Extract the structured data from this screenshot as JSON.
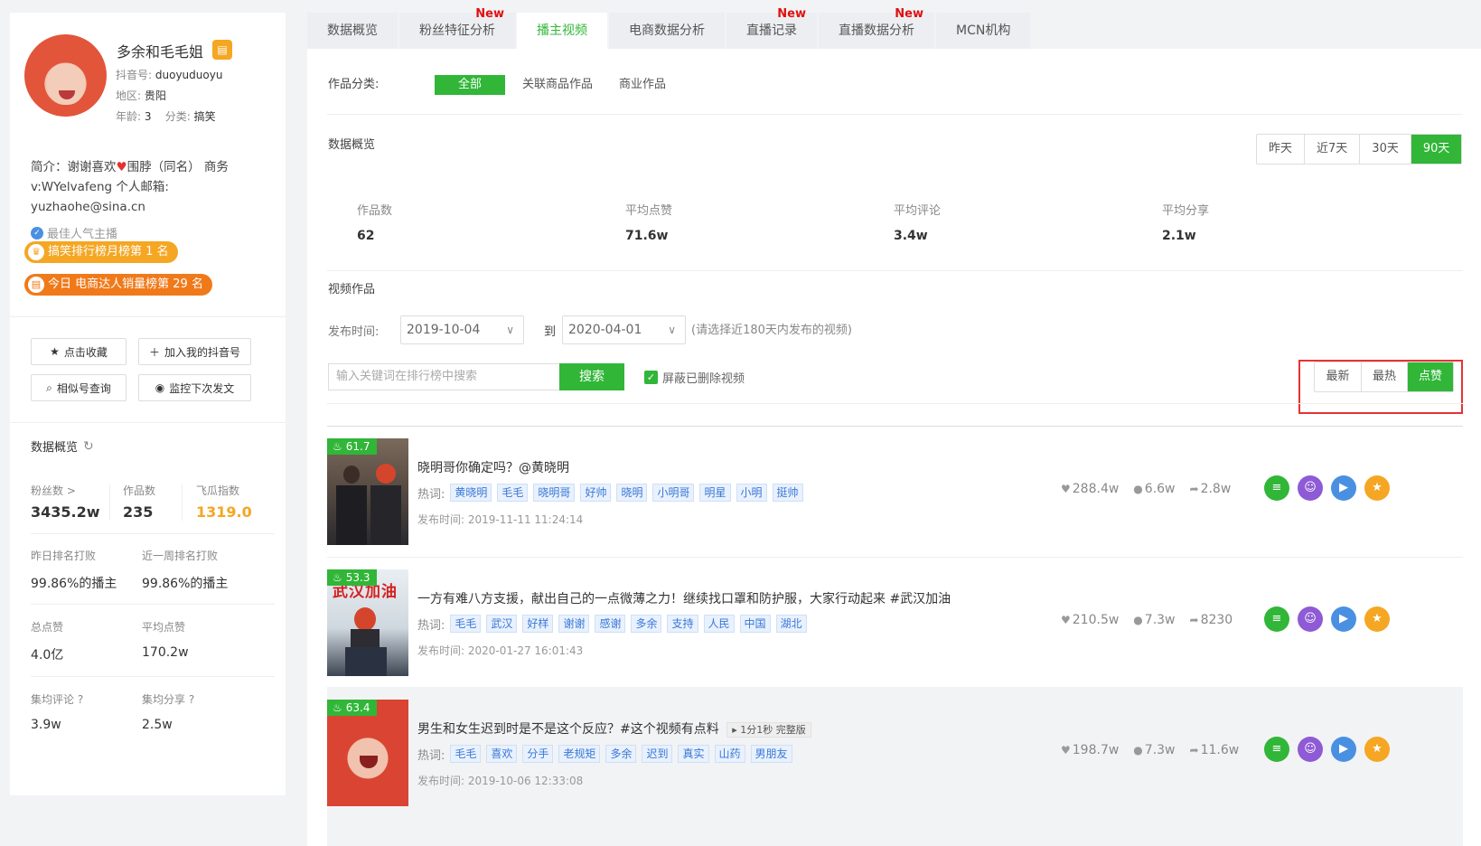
{
  "profile": {
    "name": "多余和毛毛姐",
    "badge_icon": "shop-icon",
    "douyin_label": "抖音号:",
    "douyin_id": "duoyuduoyu",
    "region_label": "地区:",
    "region": "贵阳",
    "age_label": "年龄:",
    "age": "3",
    "category_label": "分类:",
    "category": "搞笑",
    "intro_line1_a": "简介：谢谢喜欢",
    "intro_line1_b": "围脖（同名） 商务",
    "intro_line2": "v:WYelvafeng 个人邮箱:",
    "intro_line3": "yuzhaohe@sina.cn",
    "verified": "最佳人气主播",
    "rank1": "搞笑排行榜月榜第 1 名",
    "rank2": "今日 电商达人销量榜第 29 名"
  },
  "actions": {
    "favorite": "点击收藏",
    "add": "加入我的抖音号",
    "similar": "相似号查询",
    "monitor": "监控下次发文"
  },
  "stats": {
    "title": "数据概览",
    "fans_label": "粉丝数 >",
    "fans": "3435.2w",
    "works_label": "作品数",
    "works": "235",
    "index_label": "飞瓜指数",
    "index": "1319.0",
    "yest_rank_label": "昨日排名打败",
    "yest_rank": "99.86%的播主",
    "week_rank_label": "近一周排名打败",
    "week_rank": "99.86%的播主",
    "total_likes_label": "总点赞",
    "total_likes": "4.0亿",
    "avg_likes_label": "平均点赞",
    "avg_likes": "170.2w",
    "avg_comments_label": "集均评论 ?",
    "avg_comments": "3.9w",
    "avg_shares_label": "集均分享 ?",
    "avg_shares": "2.5w"
  },
  "tabs": [
    {
      "label": "数据概览",
      "new": ""
    },
    {
      "label": "粉丝特征分析",
      "new": "New"
    },
    {
      "label": "播主视频",
      "new": ""
    },
    {
      "label": "电商数据分析",
      "new": ""
    },
    {
      "label": "直播记录",
      "new": "New"
    },
    {
      "label": "直播数据分析",
      "new": "New"
    },
    {
      "label": "MCN机构",
      "new": ""
    }
  ],
  "category": {
    "label": "作品分类:",
    "all": "全部",
    "related": "关联商品作品",
    "commercial": "商业作品"
  },
  "overview": {
    "title": "数据概览",
    "periods": [
      "昨天",
      "近7天",
      "30天",
      "90天"
    ],
    "works_label": "作品数",
    "works": "62",
    "avg_likes_label": "平均点赞",
    "avg_likes": "71.6w",
    "avg_comments_label": "平均评论",
    "avg_comments": "3.4w",
    "avg_shares_label": "平均分享",
    "avg_shares": "2.1w"
  },
  "videos_section": {
    "title": "视频作品",
    "date_label": "发布时间:",
    "start_date": "2019-10-04",
    "to": "到",
    "end_date": "2020-04-01",
    "date_hint": "(请选择近180天内发布的视频)",
    "search_placeholder": "输入关键词在排行榜中搜索",
    "search_button": "搜索",
    "hide_deleted": "屏蔽已删除视频",
    "sort": [
      "最新",
      "最热",
      "点赞"
    ]
  },
  "videos": [
    {
      "score": "61.7",
      "title": "晓明哥你确定吗？@黄晓明",
      "duration": "",
      "hot_label": "热词:",
      "tags": [
        "黄晓明",
        "毛毛",
        "晓明哥",
        "好帅",
        "晓明",
        "小明哥",
        "明星",
        "小明",
        "挺帅"
      ],
      "published": "发布时间: 2019-11-11 11:24:14",
      "likes": "288.4w",
      "comments": "6.6w",
      "shares": "2.8w"
    },
    {
      "score": "53.3",
      "title": "一方有难八方支援，献出自己的一点微薄之力！继续找口罩和防护服，大家行动起来 #武汉加油",
      "duration": "",
      "thumb_text": "武汉加油",
      "hot_label": "热词:",
      "tags": [
        "毛毛",
        "武汉",
        "好样",
        "谢谢",
        "感谢",
        "多余",
        "支持",
        "人民",
        "中国",
        "湖北"
      ],
      "published": "发布时间: 2020-01-27 16:01:43",
      "likes": "210.5w",
      "comments": "7.3w",
      "shares": "8230"
    },
    {
      "score": "63.4",
      "title": "男生和女生迟到时是不是这个反应？#这个视频有点料",
      "duration": "1分1秒 完整版",
      "hot_label": "热词:",
      "tags": [
        "毛毛",
        "喜欢",
        "分手",
        "老规矩",
        "多余",
        "迟到",
        "真实",
        "山药",
        "男朋友"
      ],
      "published": "发布时间: 2019-10-06 12:33:08",
      "likes": "198.7w",
      "comments": "7.3w",
      "shares": "11.6w"
    }
  ],
  "colors": {
    "accent": "#31b638",
    "orange": "#f5a623",
    "new": "#e01010",
    "highlight": "#e53333"
  }
}
